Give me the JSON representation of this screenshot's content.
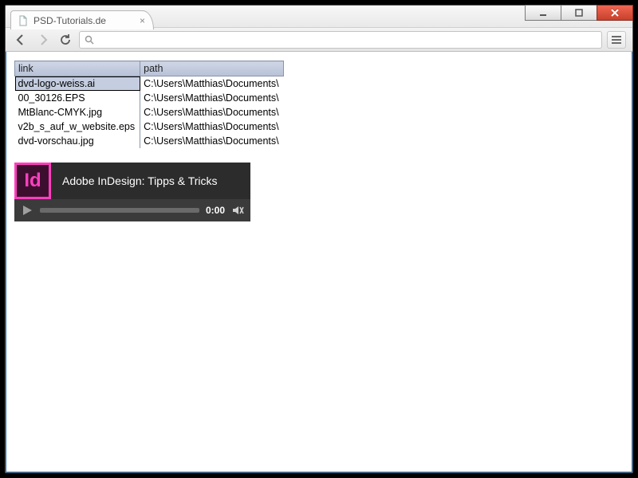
{
  "tab": {
    "title": "PSD-Tutorials.de"
  },
  "omnibox": {
    "value": ""
  },
  "table": {
    "headers": {
      "link": "link",
      "path": "path"
    },
    "rows": [
      {
        "link": "dvd-logo-weiss.ai",
        "path": "C:\\Users\\Matthias\\Documents\\",
        "selected": true
      },
      {
        "link": "00_30126.EPS",
        "path": "C:\\Users\\Matthias\\Documents\\",
        "selected": false
      },
      {
        "link": "MtBlanc-CMYK.jpg",
        "path": "C:\\Users\\Matthias\\Documents\\",
        "selected": false
      },
      {
        "link": "v2b_s_auf_w_website.eps",
        "path": "C:\\Users\\Matthias\\Documents\\",
        "selected": false
      },
      {
        "link": "dvd-vorschau.jpg",
        "path": "C:\\Users\\Matthias\\Documents\\",
        "selected": false
      }
    ]
  },
  "video": {
    "badge": "Id",
    "title": "Adobe InDesign: Tipps & Tricks",
    "time": "0:00"
  }
}
